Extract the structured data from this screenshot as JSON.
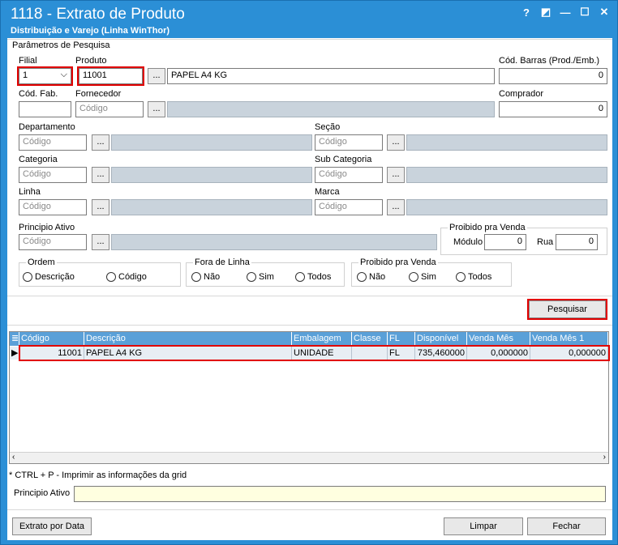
{
  "window": {
    "title": "1118 - Extrato de Produto",
    "subtitle": "Distribuição e Varejo (Linha WinThor)",
    "buttons": [
      "?",
      "◩",
      "—",
      "☐",
      "✕"
    ]
  },
  "params": {
    "group_title": "Parâmetros de Pesquisa",
    "filial_label": "Filial",
    "filial_value": "1",
    "produto_label": "Produto",
    "produto_code": "11001",
    "produto_desc": "PAPEL A4 KG",
    "cod_barras_label": "Cód. Barras (Prod./Emb.)",
    "cod_barras_value": "0",
    "cod_fab_label": "Cód. Fab.",
    "fornecedor_label": "Fornecedor",
    "comprador_label": "Comprador",
    "comprador_value": "0",
    "departamento_label": "Departamento",
    "secao_label": "Seção",
    "categoria_label": "Categoria",
    "subcategoria_label": "Sub Categoria",
    "linha_label": "Linha",
    "marca_label": "Marca",
    "principio_label": "Principio Ativo",
    "placeholder_codigo": "Código",
    "ellipsis": "...",
    "proibido_title": "Proibido pra Venda",
    "modulo_label": "Módulo",
    "modulo_value": "0",
    "rua_label": "Rua",
    "rua_value": "0"
  },
  "ordem": {
    "title": "Ordem",
    "opt1": "Descrição",
    "opt2": "Código"
  },
  "fora_linha": {
    "title": "Fora de Linha",
    "opt1": "Não",
    "opt2": "Sim",
    "opt3": "Todos"
  },
  "proibido_venda": {
    "title": "Proibido pra Venda",
    "opt1": "Não",
    "opt2": "Sim",
    "opt3": "Todos"
  },
  "pesquisar_label": "Pesquisar",
  "grid": {
    "columns": [
      "Código",
      "Descrição",
      "Embalagem",
      "Classe",
      "FL",
      "Disponível",
      "Venda Mês",
      "Venda Mês 1"
    ],
    "rows": [
      [
        "11001",
        "PAPEL A4 KG",
        "UNIDADE",
        "",
        "FL",
        "735,460000",
        "0,000000",
        "0,000000"
      ]
    ]
  },
  "hint": "* CTRL + P - Imprimir as informações da grid",
  "principio_footer_label": "Principio Ativo",
  "footer": {
    "extrato": "Extrato por Data",
    "limpar": "Limpar",
    "fechar": "Fechar"
  }
}
